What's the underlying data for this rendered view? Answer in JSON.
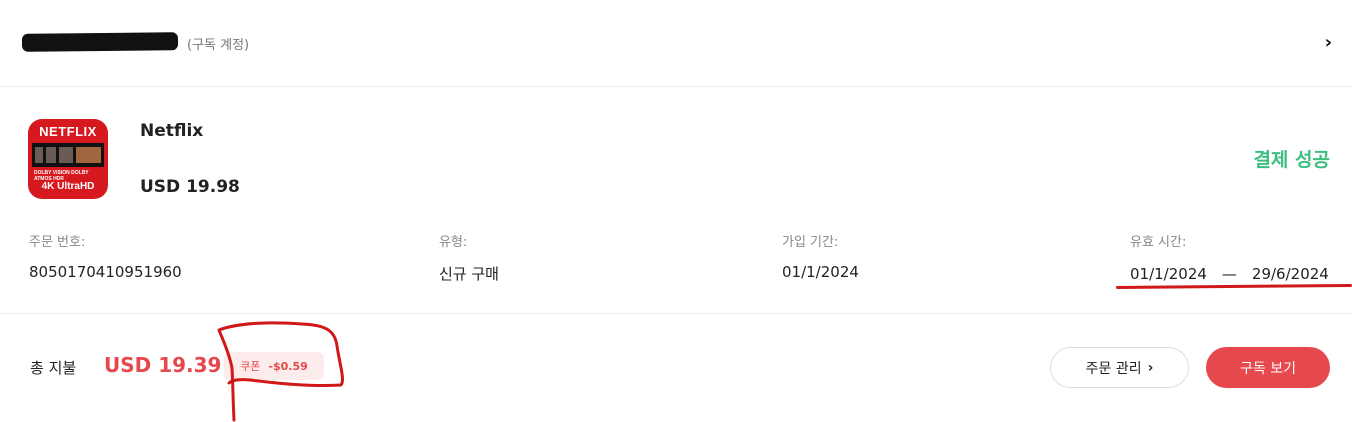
{
  "account": {
    "hint": "(구독 계정)",
    "chevron": "›"
  },
  "product": {
    "icon_brand": "NETFLIX",
    "icon_tags": "DOLBY VISION   DOLBY ATMOS   HDR",
    "icon_resolution": "4K UltraHD",
    "name": "Netflix",
    "price": "USD 19.98",
    "status": "결제 성공"
  },
  "fields": {
    "order_no_label": "주문 번호:",
    "order_no_value": "8050170410951960",
    "type_label": "유형:",
    "type_value": "신규 구매",
    "signup_label": "가입 기간:",
    "signup_value": "01/1/2024",
    "validity_label": "유효 시간:",
    "validity_value": "01/1/2024　—　29/6/2024"
  },
  "footer": {
    "total_label": "총 지불",
    "total_amount": "USD 19.39",
    "coupon_label": "쿠폰",
    "coupon_amount": "-$0.59",
    "manage_label": "주문 관리",
    "manage_chevron": "›",
    "view_label": "구독 보기"
  },
  "colors": {
    "accent": "#e5484d",
    "success": "#3cbf7e",
    "annotation": "#d01818"
  }
}
